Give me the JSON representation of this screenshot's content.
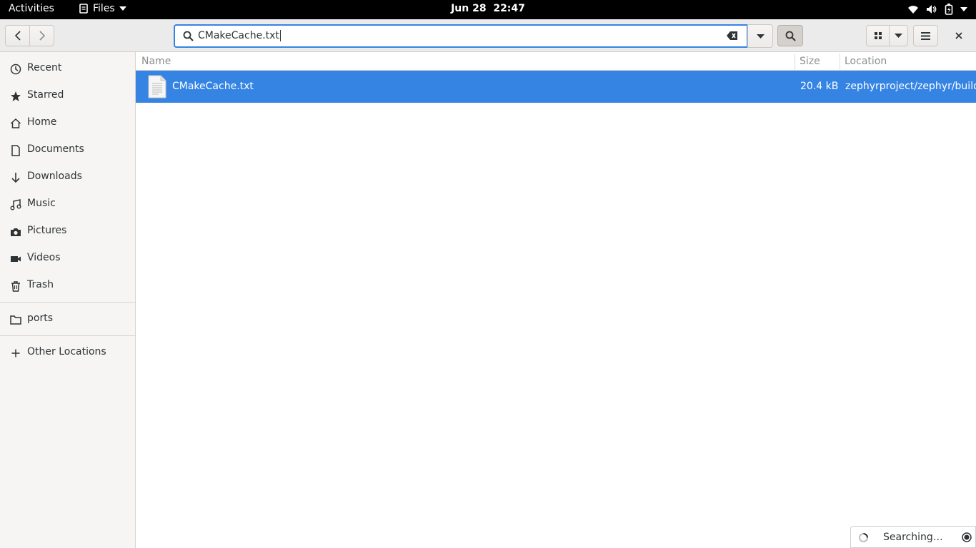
{
  "topbar": {
    "activities": "Activities",
    "app_name": "Files",
    "date": "Jun 28",
    "time": "22:47"
  },
  "header": {
    "search_value": "CMakeCache.txt"
  },
  "sidebar": {
    "items": [
      {
        "label": "Recent",
        "icon": "clock-icon"
      },
      {
        "label": "Starred",
        "icon": "star-icon"
      },
      {
        "label": "Home",
        "icon": "home-icon"
      },
      {
        "label": "Documents",
        "icon": "document-icon"
      },
      {
        "label": "Downloads",
        "icon": "download-icon"
      },
      {
        "label": "Music",
        "icon": "music-icon"
      },
      {
        "label": "Pictures",
        "icon": "camera-icon"
      },
      {
        "label": "Videos",
        "icon": "video-icon"
      },
      {
        "label": "Trash",
        "icon": "trash-icon"
      }
    ],
    "bookmarks": [
      {
        "label": "ports",
        "icon": "folder-icon"
      }
    ],
    "other": {
      "label": "Other Locations",
      "icon": "plus-icon"
    }
  },
  "list": {
    "columns": {
      "name": "Name",
      "size": "Size",
      "location": "Location"
    },
    "rows": [
      {
        "name": "CMakeCache.txt",
        "size": "20.4 kB",
        "location": "zephyrproject/zephyr/build",
        "selected": true
      }
    ]
  },
  "status": {
    "text": "Searching…"
  },
  "colors": {
    "accent": "#3584e4",
    "topbar": "#000000",
    "sidebar_bg": "#f6f5f4"
  }
}
